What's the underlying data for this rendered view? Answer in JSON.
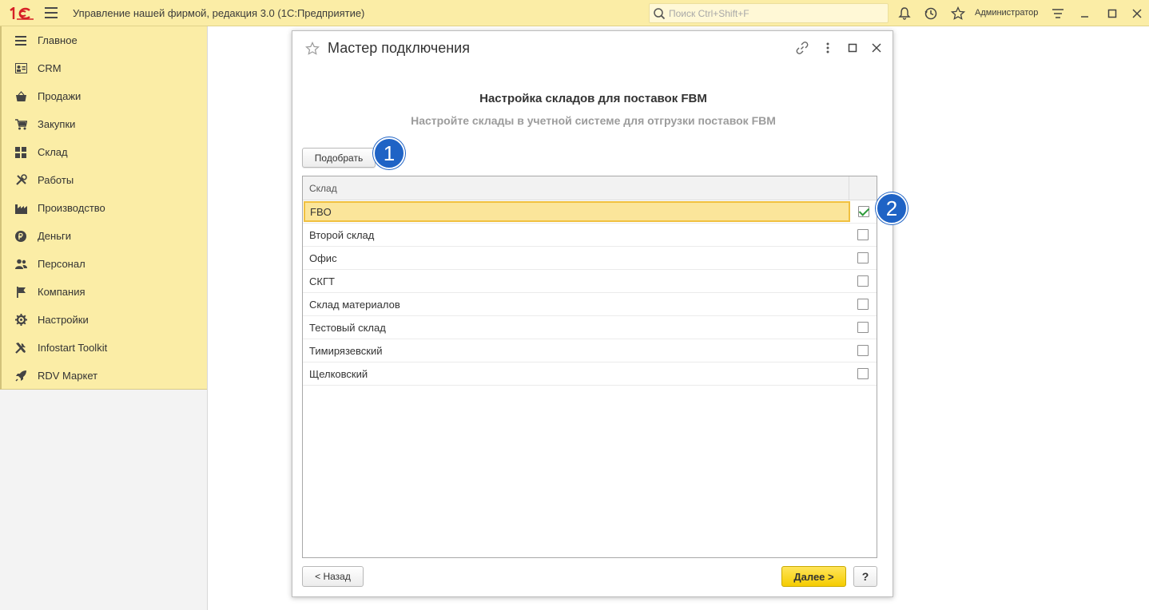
{
  "app": {
    "logo_text": "1С",
    "title": "Управление нашей фирмой, редакция 3.0  (1С:Предприятие)",
    "search_placeholder": "Поиск Ctrl+Shift+F",
    "user": "Администратор"
  },
  "sidebar": {
    "items": [
      {
        "label": "Главное",
        "icon": "list-icon"
      },
      {
        "label": "CRM",
        "icon": "contact-card-icon"
      },
      {
        "label": "Продажи",
        "icon": "basket-icon"
      },
      {
        "label": "Закупки",
        "icon": "cart-icon"
      },
      {
        "label": "Склад",
        "icon": "warehouse-grid-icon"
      },
      {
        "label": "Работы",
        "icon": "tools-icon"
      },
      {
        "label": "Производство",
        "icon": "factory-icon"
      },
      {
        "label": "Деньги",
        "icon": "ruble-icon"
      },
      {
        "label": "Персонал",
        "icon": "people-icon"
      },
      {
        "label": "Компания",
        "icon": "flag-icon"
      },
      {
        "label": "Настройки",
        "icon": "gear-icon"
      },
      {
        "label": "Infostart Toolkit",
        "icon": "wrench-icon"
      },
      {
        "label": "RDV Маркет",
        "icon": "rocket-icon"
      }
    ]
  },
  "dialog": {
    "title": "Мастер подключения",
    "heading": "Настройка складов для поставок FBM",
    "subheading": "Настройте склады в учетной системе для отгрузки поставок FBM",
    "pick_button": "Подобрать",
    "badge_1": "1",
    "badge_2": "2",
    "grid": {
      "column_name": "Склад",
      "rows": [
        {
          "name": "FBO",
          "checked": true
        },
        {
          "name": "Второй склад",
          "checked": false
        },
        {
          "name": "Офис",
          "checked": false
        },
        {
          "name": "СКГТ",
          "checked": false
        },
        {
          "name": "Склад материалов",
          "checked": false
        },
        {
          "name": "Тестовый склад",
          "checked": false
        },
        {
          "name": "Тимирязевский",
          "checked": false
        },
        {
          "name": "Щелковский",
          "checked": false
        }
      ]
    },
    "back_button": "< Назад",
    "next_button": "Далее >",
    "help_button": "?"
  },
  "colors": {
    "accent_yellow": "#fbeda6",
    "badge_blue": "#1f63c5",
    "next_button": "#f5cc00"
  }
}
